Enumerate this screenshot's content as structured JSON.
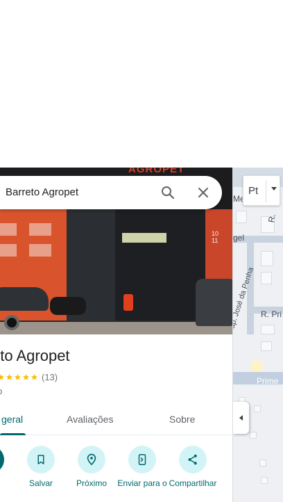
{
  "search": {
    "value": "Barreto Agropet"
  },
  "photo": {
    "sign_text": "AGROPET",
    "building_number": "1011"
  },
  "place": {
    "name": "Barreto Agropet",
    "name_visible": "eto Agropet",
    "rating_count": "(13)",
    "category_visible": "p"
  },
  "tabs": [
    {
      "label": "geral",
      "active": true
    },
    {
      "label": "Avaliações",
      "active": false
    },
    {
      "label": "Sobre",
      "active": false
    }
  ],
  "actions": [
    {
      "label": "s",
      "icon": "directions-icon"
    },
    {
      "label": "Salvar",
      "icon": "bookmark-icon"
    },
    {
      "label": "Próximo",
      "icon": "nearby-icon"
    },
    {
      "label": "Enviar para o",
      "icon": "send-to-phone-icon"
    },
    {
      "label": "Compartilhar",
      "icon": "share-icon"
    }
  ],
  "map": {
    "labels": [
      "Me",
      "R.",
      "gel",
      "R. Cap. José da Penha",
      "R. Pri",
      "Prime"
    ],
    "layer_button": "Pt",
    "colors": {
      "water_roads": "#c9d3df",
      "accent": "#01696e",
      "action_bg": "#d3f4f6",
      "star": "#fbbc04"
    }
  }
}
